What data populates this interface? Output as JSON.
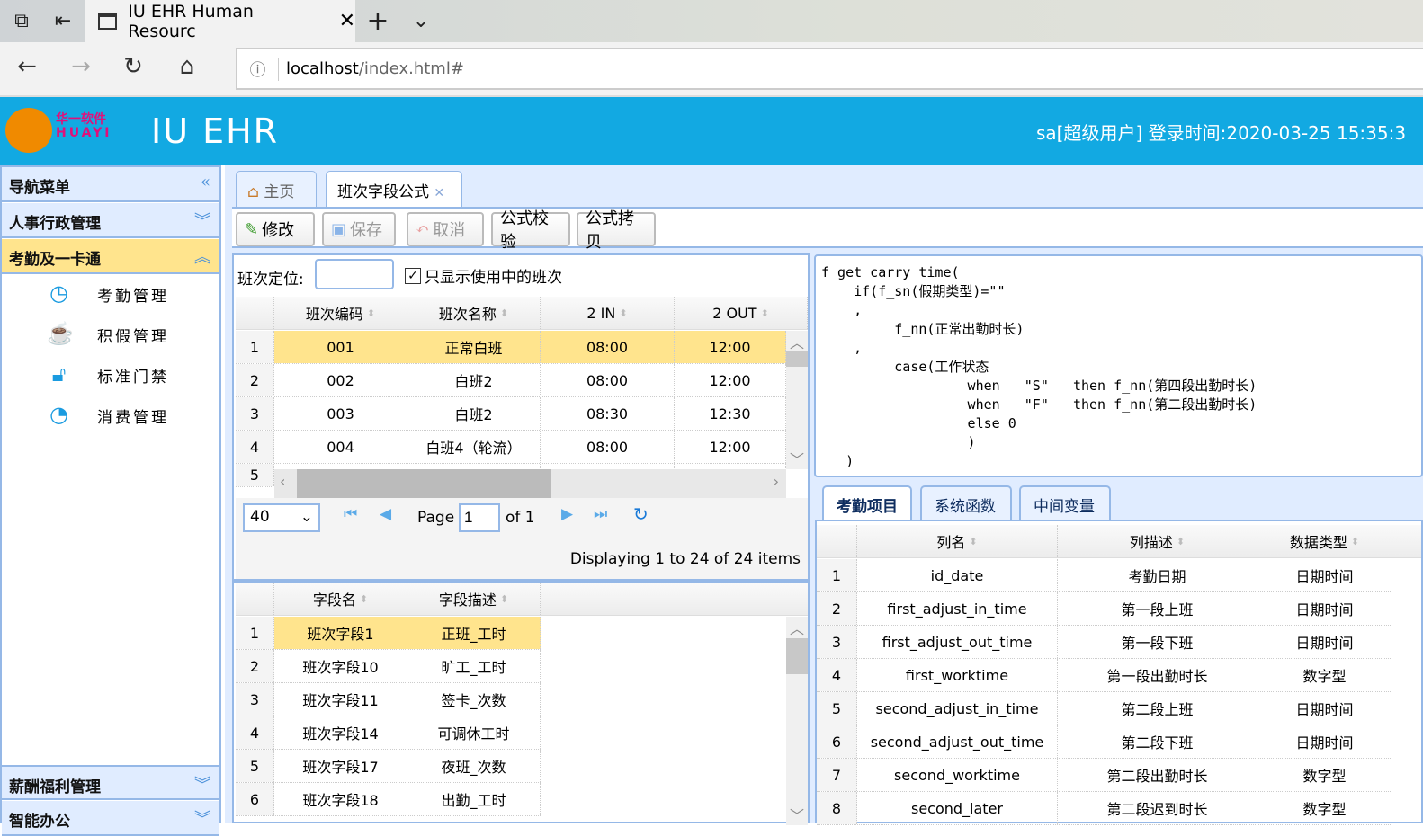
{
  "browser": {
    "tab_title": "IU EHR Human Resourc",
    "url_host": "localhost",
    "url_path": "/index.html#"
  },
  "header": {
    "logo_cn": "华一软件",
    "logo_en": "HUAYI",
    "app_title": "IU EHR",
    "user_info": "sa[超级用户] 登录时间:2020-03-25 15:35:3"
  },
  "sidebar": {
    "title": "导航菜单",
    "groups": [
      {
        "label": "人事行政管理"
      },
      {
        "label": "考勤及一卡通"
      },
      {
        "label": "薪酬福利管理"
      },
      {
        "label": "智能办公"
      }
    ],
    "items": [
      {
        "label": "考勤管理",
        "icon": "clock-icon"
      },
      {
        "label": "积假管理",
        "icon": "cup-icon"
      },
      {
        "label": "标准门禁",
        "icon": "unlock-icon"
      },
      {
        "label": "消费管理",
        "icon": "gauge-icon"
      }
    ]
  },
  "tabs": [
    {
      "label": "主页"
    },
    {
      "label": "班次字段公式"
    }
  ],
  "toolbar": {
    "edit": "修改",
    "save": "保存",
    "cancel": "取消",
    "validate": "公式校验",
    "copy": "公式拷贝"
  },
  "filter": {
    "label": "班次定位:",
    "value": "",
    "checkbox_label": "只显示使用中的班次",
    "checked": true
  },
  "shift_grid": {
    "columns": [
      "班次编码",
      "班次名称",
      "2 IN",
      "2 OUT"
    ],
    "rows": [
      [
        "1",
        "001",
        "正常白班",
        "08:00",
        "12:00"
      ],
      [
        "2",
        "002",
        "白班2",
        "08:00",
        "12:00"
      ],
      [
        "3",
        "003",
        "白班2",
        "08:30",
        "12:30"
      ],
      [
        "4",
        "004",
        "白班4（轮流）",
        "08:00",
        "12:00"
      ],
      [
        "5",
        "",
        "",
        "",
        ""
      ]
    ]
  },
  "pager": {
    "page_size": "40",
    "page_label": "Page",
    "page": "1",
    "of_label": "of 1",
    "display": "Displaying 1 to 24 of 24 items"
  },
  "field_grid": {
    "columns": [
      "字段名",
      "字段描述"
    ],
    "rows": [
      [
        "1",
        "班次字段1",
        "正班_工时"
      ],
      [
        "2",
        "班次字段10",
        "旷工_工时"
      ],
      [
        "3",
        "班次字段11",
        "签卡_次数"
      ],
      [
        "4",
        "班次字段14",
        "可调休工时"
      ],
      [
        "5",
        "班次字段17",
        "夜班_次数"
      ],
      [
        "6",
        "班次字段18",
        "出勤_工时"
      ]
    ]
  },
  "formula": "f_get_carry_time(\n    if(f_sn(假期类型)=\"\"\n    ,\n         f_nn(正常出勤时长)\n    ,\n         case(工作状态\n                  when   \"S\"   then f_nn(第四段出勤时长)\n                  when   \"F\"   then f_nn(第二段出勤时长)\n                  else 0\n                  )\n   )",
  "ref_tabs": [
    {
      "label": "考勤项目"
    },
    {
      "label": "系统函数"
    },
    {
      "label": "中间变量"
    }
  ],
  "ref_grid": {
    "columns": [
      "列名",
      "列描述",
      "数据类型"
    ],
    "rows": [
      [
        "1",
        "id_date",
        "考勤日期",
        "日期时间"
      ],
      [
        "2",
        "first_adjust_in_time",
        "第一段上班",
        "日期时间"
      ],
      [
        "3",
        "first_adjust_out_time",
        "第一段下班",
        "日期时间"
      ],
      [
        "4",
        "first_worktime",
        "第一段出勤时长",
        "数字型"
      ],
      [
        "5",
        "second_adjust_in_time",
        "第二段上班",
        "日期时间"
      ],
      [
        "6",
        "second_adjust_out_time",
        "第二段下班",
        "日期时间"
      ],
      [
        "7",
        "second_worktime",
        "第二段出勤时长",
        "数字型"
      ],
      [
        "8",
        "second_later",
        "第二段迟到时长",
        "数字型"
      ]
    ]
  },
  "colors": {
    "header": "#12a9e2",
    "selected_row": "#ffe48d",
    "panel_border": "#95b8e7",
    "panel_bg": "#e0ecff"
  }
}
